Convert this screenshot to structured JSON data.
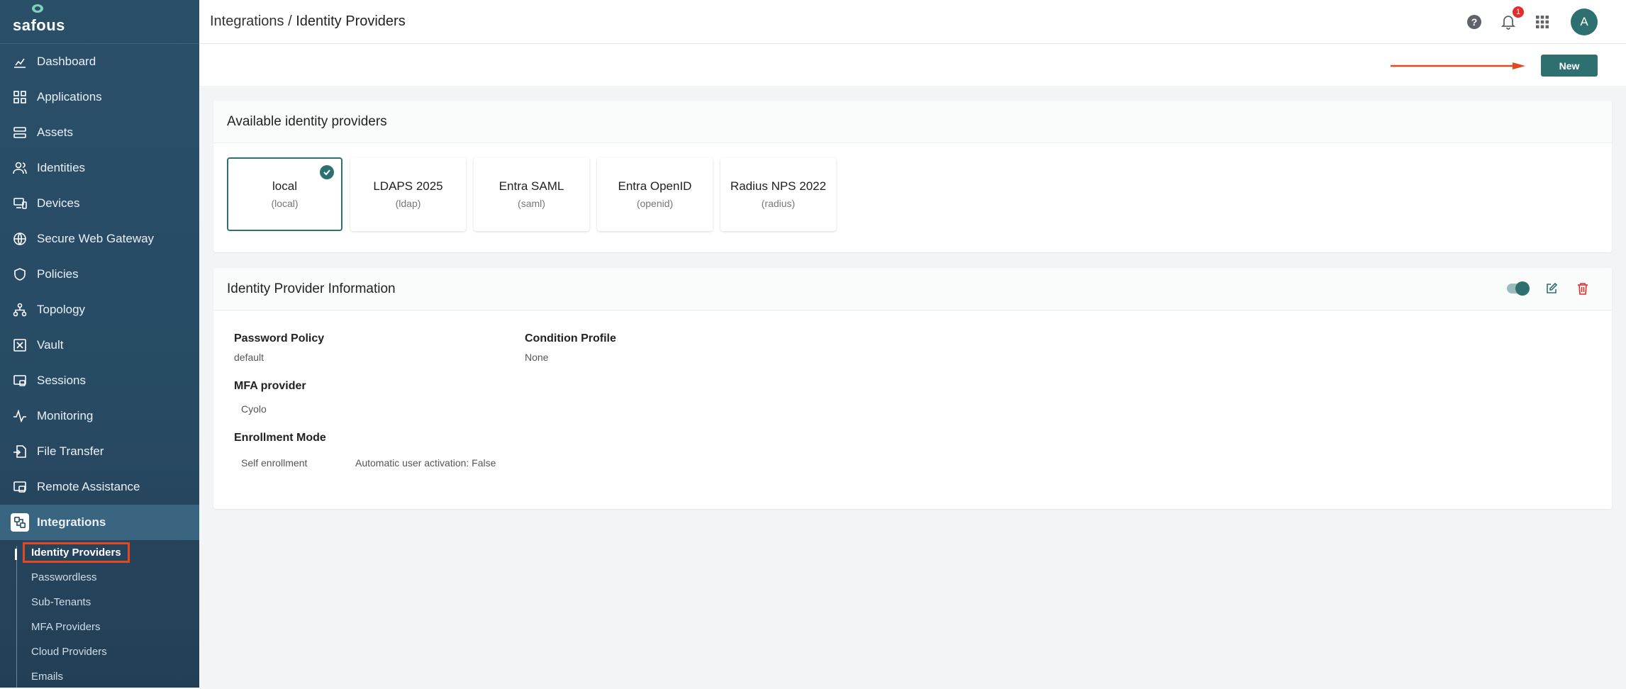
{
  "brand": {
    "name": "safous"
  },
  "sidebar": {
    "items": [
      {
        "label": "Dashboard"
      },
      {
        "label": "Applications"
      },
      {
        "label": "Assets"
      },
      {
        "label": "Identities"
      },
      {
        "label": "Devices"
      },
      {
        "label": "Secure Web Gateway"
      },
      {
        "label": "Policies"
      },
      {
        "label": "Topology"
      },
      {
        "label": "Vault"
      },
      {
        "label": "Sessions"
      },
      {
        "label": "Monitoring"
      },
      {
        "label": "File Transfer"
      },
      {
        "label": "Remote Assistance"
      },
      {
        "label": "Integrations"
      }
    ],
    "submenu": [
      {
        "label": "Identity Providers"
      },
      {
        "label": "Passwordless"
      },
      {
        "label": "Sub-Tenants"
      },
      {
        "label": "MFA Providers"
      },
      {
        "label": "Cloud Providers"
      },
      {
        "label": "Emails"
      }
    ]
  },
  "header": {
    "breadcrumb_parent": "Integrations",
    "breadcrumb_sep": " / ",
    "breadcrumb_current": "Identity Providers",
    "notification_count": "1",
    "avatar_initial": "A"
  },
  "toolbar": {
    "new_label": "New"
  },
  "providers_card": {
    "title": "Available identity providers",
    "providers": [
      {
        "name": "local",
        "type": "(local)"
      },
      {
        "name": "LDAPS 2025",
        "type": "(ldap)"
      },
      {
        "name": "Entra SAML",
        "type": "(saml)"
      },
      {
        "name": "Entra OpenID",
        "type": "(openid)"
      },
      {
        "name": "Radius NPS 2022",
        "type": "(radius)"
      }
    ]
  },
  "info_card": {
    "title": "Identity Provider Information",
    "password_policy_label": "Password Policy",
    "password_policy_value": "default",
    "condition_profile_label": "Condition Profile",
    "condition_profile_value": "None",
    "mfa_label": "MFA provider",
    "mfa_value": "Cyolo",
    "enrollment_label": "Enrollment Mode",
    "enrollment_value": "Self enrollment",
    "auto_activation": "Automatic user activation: False"
  },
  "colors": {
    "accent": "#2e7070",
    "sidebar": "#284b64",
    "highlight": "#e3481f",
    "danger": "#e02d2d"
  }
}
